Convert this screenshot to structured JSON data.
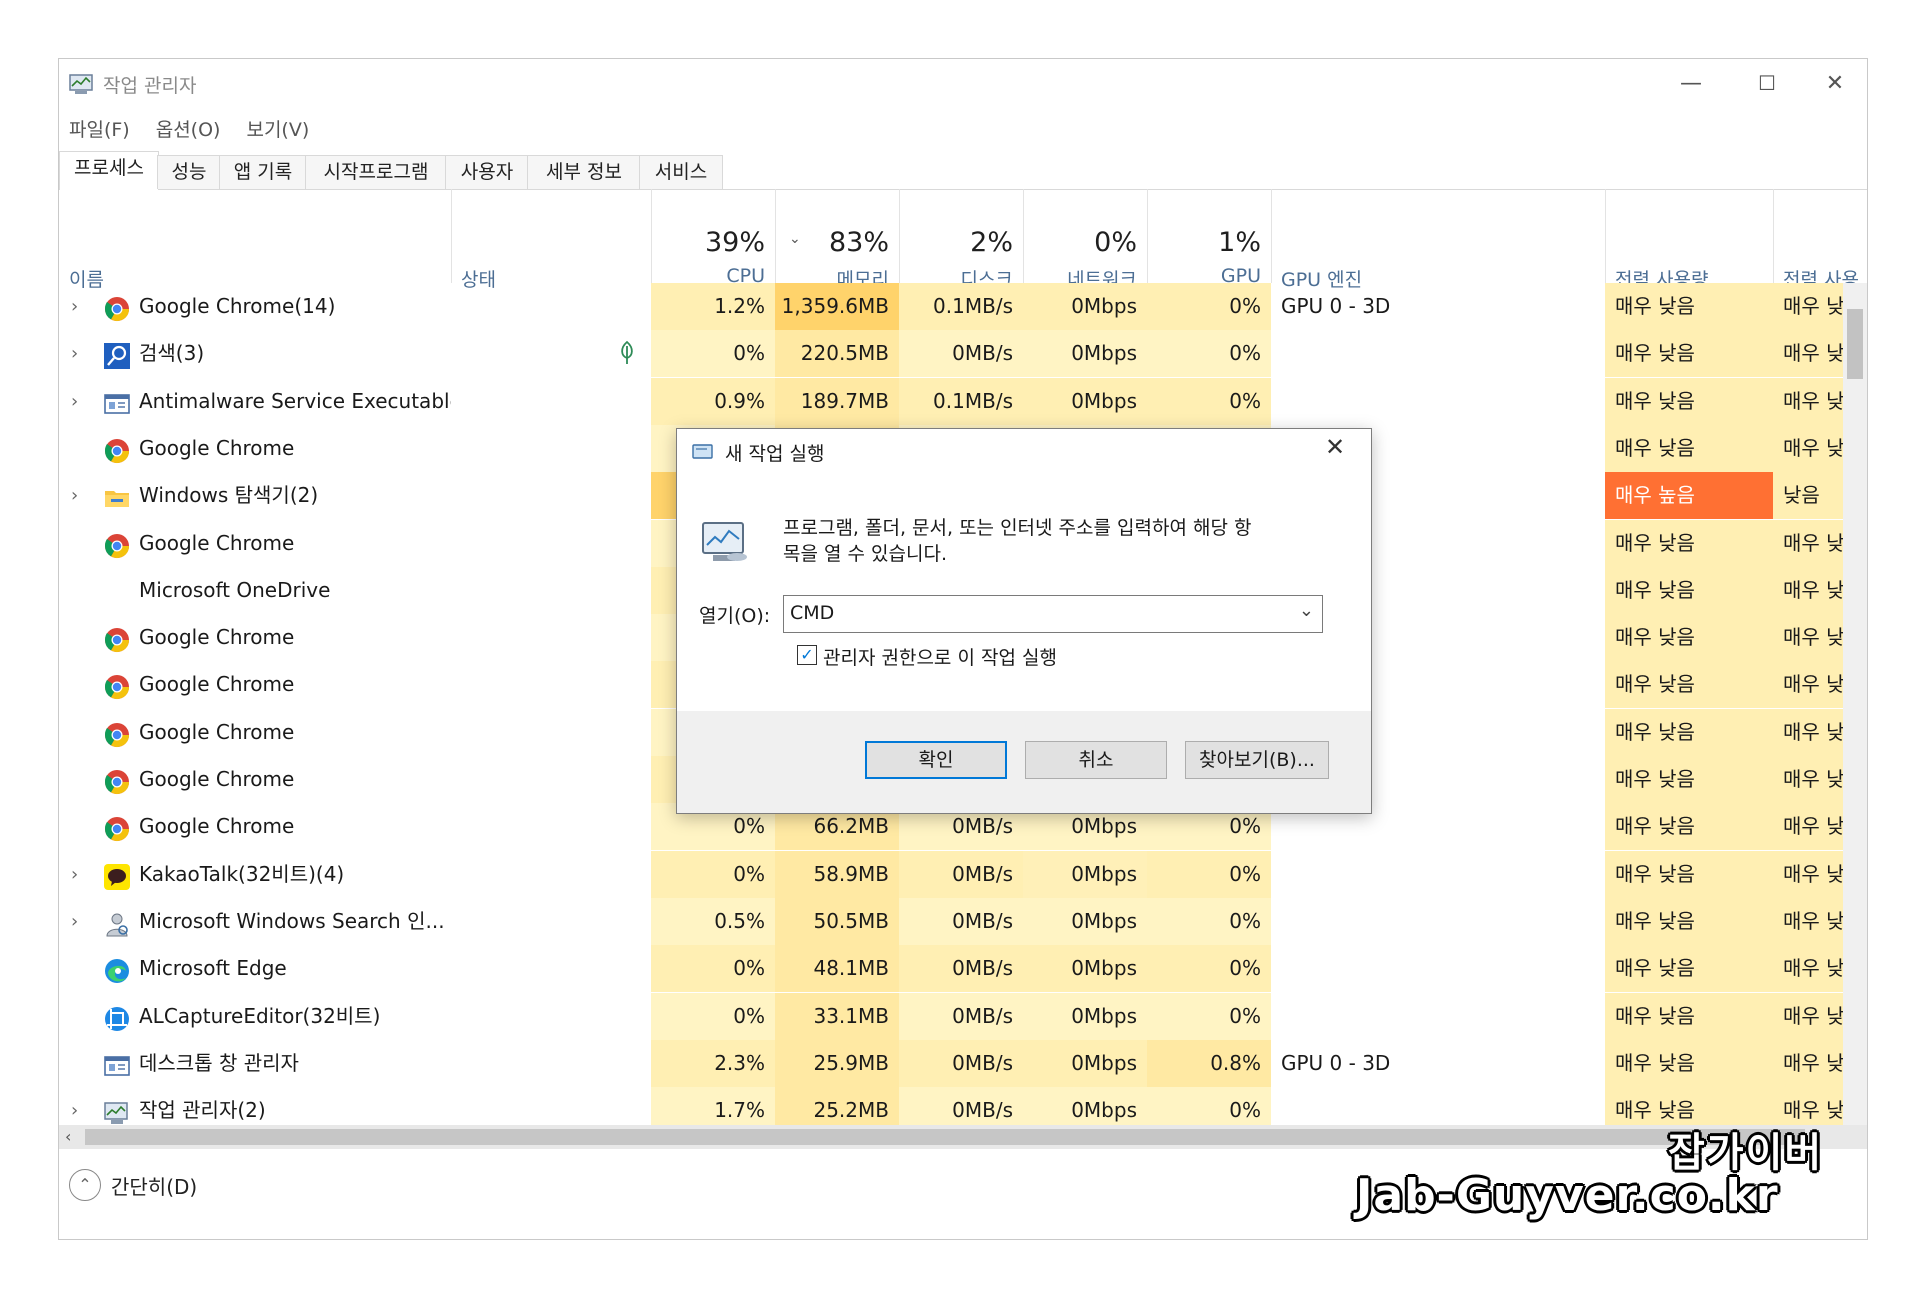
{
  "window": {
    "title": "작업 관리자",
    "minimize": "—",
    "maximize": "☐",
    "close": "✕"
  },
  "menu": [
    "파일(F)",
    "옵션(O)",
    "보기(V)"
  ],
  "tabs": [
    "프로세스",
    "성능",
    "앱 기록",
    "시작프로그램",
    "사용자",
    "세부 정보",
    "서비스"
  ],
  "columns": {
    "name": "이름",
    "status": "상태",
    "cpu": {
      "pct": "39%",
      "label": "CPU"
    },
    "memory": {
      "pct": "83%",
      "label": "메모리"
    },
    "disk": {
      "pct": "2%",
      "label": "디스크"
    },
    "network": {
      "pct": "0%",
      "label": "네트워크"
    },
    "gpu": {
      "pct": "1%",
      "label": "GPU"
    },
    "gpu_engine": "GPU 엔진",
    "power": "전력 사용량",
    "power_trend": "전력 사용"
  },
  "rows": [
    {
      "name": "Google Chrome(14)",
      "icon": "chrome-icon",
      "expand": true,
      "cpu": "1.2%",
      "mem": "1,359.6MB",
      "disk": "0.1MB/s",
      "net": "0Mbps",
      "gpu": "0%",
      "engine": "GPU 0 - 3D",
      "power": "매우 낮음",
      "trend": "매우 낮음"
    },
    {
      "name": "검색(3)",
      "icon": "search-app-icon",
      "expand": true,
      "status_icon": true,
      "cpu": "0%",
      "mem": "220.5MB",
      "disk": "0MB/s",
      "net": "0Mbps",
      "gpu": "0%",
      "engine": "",
      "power": "매우 낮음",
      "trend": "매우 낮음"
    },
    {
      "name": "Antimalware Service Executable",
      "icon": "service-icon",
      "expand": true,
      "cpu": "0.9%",
      "mem": "189.7MB",
      "disk": "0.1MB/s",
      "net": "0Mbps",
      "gpu": "0%",
      "engine": "",
      "power": "매우 낮음",
      "trend": "매우 낮음"
    },
    {
      "name": "Google Chrome",
      "icon": "chrome-icon",
      "expand": false,
      "cpu": "",
      "mem": "",
      "disk": "",
      "net": "",
      "gpu": "",
      "engine": "",
      "power": "매우 낮음",
      "trend": "매우 낮음"
    },
    {
      "name": "Windows 탐색기(2)",
      "icon": "folder-icon",
      "expand": true,
      "cpu": "",
      "mem": "",
      "disk": "",
      "net": "",
      "gpu": "",
      "engine": "",
      "power": "매우 높음",
      "trend": "낮음",
      "hot": true
    },
    {
      "name": "Google Chrome",
      "icon": "chrome-icon",
      "expand": false,
      "cpu": "",
      "mem": "",
      "disk": "",
      "net": "",
      "gpu": "",
      "engine": "",
      "power": "매우 낮음",
      "trend": "매우 낮음"
    },
    {
      "name": "Microsoft OneDrive",
      "icon": "",
      "expand": false,
      "cpu": "",
      "mem": "",
      "disk": "",
      "net": "",
      "gpu": "",
      "engine": "",
      "power": "매우 낮음",
      "trend": "매우 낮음"
    },
    {
      "name": "Google Chrome",
      "icon": "chrome-icon",
      "expand": false,
      "cpu": "",
      "mem": "",
      "disk": "",
      "net": "",
      "gpu": "",
      "engine": "",
      "power": "매우 낮음",
      "trend": "매우 낮음"
    },
    {
      "name": "Google Chrome",
      "icon": "chrome-icon",
      "expand": false,
      "cpu": "",
      "mem": "",
      "disk": "",
      "net": "",
      "gpu": "",
      "engine": "",
      "power": "매우 낮음",
      "trend": "매우 낮음"
    },
    {
      "name": "Google Chrome",
      "icon": "chrome-icon",
      "expand": false,
      "cpu": "",
      "mem": "",
      "disk": "",
      "net": "",
      "gpu": "",
      "engine": "",
      "power": "매우 낮음",
      "trend": "매우 낮음"
    },
    {
      "name": "Google Chrome",
      "icon": "chrome-icon",
      "expand": false,
      "cpu": "",
      "mem": "",
      "disk": "",
      "net": "",
      "gpu": "",
      "engine": "",
      "power": "매우 낮음",
      "trend": "매우 낮음"
    },
    {
      "name": "Google Chrome",
      "icon": "chrome-icon",
      "expand": false,
      "cpu": "0%",
      "mem": "66.2MB",
      "disk": "0MB/s",
      "net": "0Mbps",
      "gpu": "0%",
      "engine": "",
      "power": "매우 낮음",
      "trend": "매우 낮음"
    },
    {
      "name": "KakaoTalk(32비트)(4)",
      "icon": "kakao-icon",
      "expand": true,
      "cpu": "0%",
      "mem": "58.9MB",
      "disk": "0MB/s",
      "net": "0Mbps",
      "gpu": "0%",
      "engine": "",
      "power": "매우 낮음",
      "trend": "매우 낮음",
      "net_hi": true
    },
    {
      "name": "Microsoft Windows Search 인...",
      "icon": "user-search-icon",
      "expand": true,
      "cpu": "0.5%",
      "mem": "50.5MB",
      "disk": "0MB/s",
      "net": "0Mbps",
      "gpu": "0%",
      "engine": "",
      "power": "매우 낮음",
      "trend": "매우 낮음"
    },
    {
      "name": "Microsoft Edge",
      "icon": "edge-icon",
      "expand": false,
      "cpu": "0%",
      "mem": "48.1MB",
      "disk": "0MB/s",
      "net": "0Mbps",
      "gpu": "0%",
      "engine": "",
      "power": "매우 낮음",
      "trend": "매우 낮음"
    },
    {
      "name": "ALCaptureEditor(32비트)",
      "icon": "alcapture-icon",
      "expand": false,
      "cpu": "0%",
      "mem": "33.1MB",
      "disk": "0MB/s",
      "net": "0Mbps",
      "gpu": "0%",
      "engine": "",
      "power": "매우 낮음",
      "trend": "매우 낮음"
    },
    {
      "name": "데스크톱 창 관리자",
      "icon": "service-icon",
      "expand": false,
      "cpu": "2.3%",
      "mem": "25.9MB",
      "disk": "0MB/s",
      "net": "0Mbps",
      "gpu": "0.8%",
      "engine": "GPU 0 - 3D",
      "power": "매우 낮음",
      "trend": "매우 낮음",
      "gpu_hi": true
    },
    {
      "name": "작업 관리자(2)",
      "icon": "taskmgr-icon",
      "expand": true,
      "cpu": "1.7%",
      "mem": "25.2MB",
      "disk": "0MB/s",
      "net": "0Mbps",
      "gpu": "0%",
      "engine": "",
      "power": "매우 낮음",
      "trend": "매우 낮음"
    }
  ],
  "footer": {
    "label": "간단히(D)"
  },
  "dialog": {
    "title": "새 작업 실행",
    "message": "프로그램, 폴더, 문서, 또는 인터넷 주소를 입력하여 해당 항목을 열 수 있습니다.",
    "message_line1": "프로그램, 폴더, 문서, 또는 인터넷 주소를 입력하여 해당 항",
    "message_line2": "목을 열 수 있습니다.",
    "open_label": "열기(O):",
    "open_value": "CMD",
    "admin_checkbox_label": "관리자 권한으로 이 작업 실행",
    "admin_checked": true,
    "ok": "확인",
    "cancel": "취소",
    "browse": "찾아보기(B)..."
  },
  "watermark": {
    "line1": "잡가이버",
    "line2": "Jab-Guyver.co.kr"
  },
  "colors": {
    "cell_light": "#fff4c4",
    "cell_mid": "#ffefb3",
    "cell_mem_hi": "#ffd36b",
    "cell_hot": "#ff7033",
    "accent": "#0078d7"
  }
}
